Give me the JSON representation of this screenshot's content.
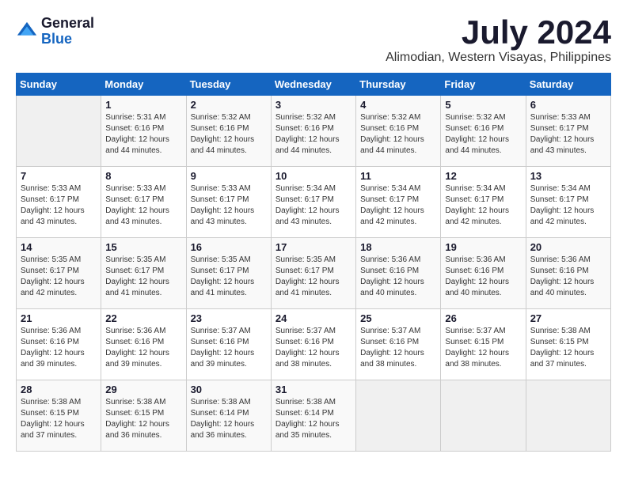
{
  "header": {
    "logo_line1": "General",
    "logo_line2": "Blue",
    "month": "July 2024",
    "location": "Alimodian, Western Visayas, Philippines"
  },
  "weekdays": [
    "Sunday",
    "Monday",
    "Tuesday",
    "Wednesday",
    "Thursday",
    "Friday",
    "Saturday"
  ],
  "weeks": [
    [
      {
        "day": "",
        "empty": true
      },
      {
        "day": "1",
        "sunrise": "Sunrise: 5:31 AM",
        "sunset": "Sunset: 6:16 PM",
        "daylight": "Daylight: 12 hours and 44 minutes."
      },
      {
        "day": "2",
        "sunrise": "Sunrise: 5:32 AM",
        "sunset": "Sunset: 6:16 PM",
        "daylight": "Daylight: 12 hours and 44 minutes."
      },
      {
        "day": "3",
        "sunrise": "Sunrise: 5:32 AM",
        "sunset": "Sunset: 6:16 PM",
        "daylight": "Daylight: 12 hours and 44 minutes."
      },
      {
        "day": "4",
        "sunrise": "Sunrise: 5:32 AM",
        "sunset": "Sunset: 6:16 PM",
        "daylight": "Daylight: 12 hours and 44 minutes."
      },
      {
        "day": "5",
        "sunrise": "Sunrise: 5:32 AM",
        "sunset": "Sunset: 6:16 PM",
        "daylight": "Daylight: 12 hours and 44 minutes."
      },
      {
        "day": "6",
        "sunrise": "Sunrise: 5:33 AM",
        "sunset": "Sunset: 6:17 PM",
        "daylight": "Daylight: 12 hours and 43 minutes."
      }
    ],
    [
      {
        "day": "7",
        "sunrise": "Sunrise: 5:33 AM",
        "sunset": "Sunset: 6:17 PM",
        "daylight": "Daylight: 12 hours and 43 minutes."
      },
      {
        "day": "8",
        "sunrise": "Sunrise: 5:33 AM",
        "sunset": "Sunset: 6:17 PM",
        "daylight": "Daylight: 12 hours and 43 minutes."
      },
      {
        "day": "9",
        "sunrise": "Sunrise: 5:33 AM",
        "sunset": "Sunset: 6:17 PM",
        "daylight": "Daylight: 12 hours and 43 minutes."
      },
      {
        "day": "10",
        "sunrise": "Sunrise: 5:34 AM",
        "sunset": "Sunset: 6:17 PM",
        "daylight": "Daylight: 12 hours and 43 minutes."
      },
      {
        "day": "11",
        "sunrise": "Sunrise: 5:34 AM",
        "sunset": "Sunset: 6:17 PM",
        "daylight": "Daylight: 12 hours and 42 minutes."
      },
      {
        "day": "12",
        "sunrise": "Sunrise: 5:34 AM",
        "sunset": "Sunset: 6:17 PM",
        "daylight": "Daylight: 12 hours and 42 minutes."
      },
      {
        "day": "13",
        "sunrise": "Sunrise: 5:34 AM",
        "sunset": "Sunset: 6:17 PM",
        "daylight": "Daylight: 12 hours and 42 minutes."
      }
    ],
    [
      {
        "day": "14",
        "sunrise": "Sunrise: 5:35 AM",
        "sunset": "Sunset: 6:17 PM",
        "daylight": "Daylight: 12 hours and 42 minutes."
      },
      {
        "day": "15",
        "sunrise": "Sunrise: 5:35 AM",
        "sunset": "Sunset: 6:17 PM",
        "daylight": "Daylight: 12 hours and 41 minutes."
      },
      {
        "day": "16",
        "sunrise": "Sunrise: 5:35 AM",
        "sunset": "Sunset: 6:17 PM",
        "daylight": "Daylight: 12 hours and 41 minutes."
      },
      {
        "day": "17",
        "sunrise": "Sunrise: 5:35 AM",
        "sunset": "Sunset: 6:17 PM",
        "daylight": "Daylight: 12 hours and 41 minutes."
      },
      {
        "day": "18",
        "sunrise": "Sunrise: 5:36 AM",
        "sunset": "Sunset: 6:16 PM",
        "daylight": "Daylight: 12 hours and 40 minutes."
      },
      {
        "day": "19",
        "sunrise": "Sunrise: 5:36 AM",
        "sunset": "Sunset: 6:16 PM",
        "daylight": "Daylight: 12 hours and 40 minutes."
      },
      {
        "day": "20",
        "sunrise": "Sunrise: 5:36 AM",
        "sunset": "Sunset: 6:16 PM",
        "daylight": "Daylight: 12 hours and 40 minutes."
      }
    ],
    [
      {
        "day": "21",
        "sunrise": "Sunrise: 5:36 AM",
        "sunset": "Sunset: 6:16 PM",
        "daylight": "Daylight: 12 hours and 39 minutes."
      },
      {
        "day": "22",
        "sunrise": "Sunrise: 5:36 AM",
        "sunset": "Sunset: 6:16 PM",
        "daylight": "Daylight: 12 hours and 39 minutes."
      },
      {
        "day": "23",
        "sunrise": "Sunrise: 5:37 AM",
        "sunset": "Sunset: 6:16 PM",
        "daylight": "Daylight: 12 hours and 39 minutes."
      },
      {
        "day": "24",
        "sunrise": "Sunrise: 5:37 AM",
        "sunset": "Sunset: 6:16 PM",
        "daylight": "Daylight: 12 hours and 38 minutes."
      },
      {
        "day": "25",
        "sunrise": "Sunrise: 5:37 AM",
        "sunset": "Sunset: 6:16 PM",
        "daylight": "Daylight: 12 hours and 38 minutes."
      },
      {
        "day": "26",
        "sunrise": "Sunrise: 5:37 AM",
        "sunset": "Sunset: 6:15 PM",
        "daylight": "Daylight: 12 hours and 38 minutes."
      },
      {
        "day": "27",
        "sunrise": "Sunrise: 5:38 AM",
        "sunset": "Sunset: 6:15 PM",
        "daylight": "Daylight: 12 hours and 37 minutes."
      }
    ],
    [
      {
        "day": "28",
        "sunrise": "Sunrise: 5:38 AM",
        "sunset": "Sunset: 6:15 PM",
        "daylight": "Daylight: 12 hours and 37 minutes."
      },
      {
        "day": "29",
        "sunrise": "Sunrise: 5:38 AM",
        "sunset": "Sunset: 6:15 PM",
        "daylight": "Daylight: 12 hours and 36 minutes."
      },
      {
        "day": "30",
        "sunrise": "Sunrise: 5:38 AM",
        "sunset": "Sunset: 6:14 PM",
        "daylight": "Daylight: 12 hours and 36 minutes."
      },
      {
        "day": "31",
        "sunrise": "Sunrise: 5:38 AM",
        "sunset": "Sunset: 6:14 PM",
        "daylight": "Daylight: 12 hours and 35 minutes."
      },
      {
        "day": "",
        "empty": true
      },
      {
        "day": "",
        "empty": true
      },
      {
        "day": "",
        "empty": true
      }
    ]
  ]
}
